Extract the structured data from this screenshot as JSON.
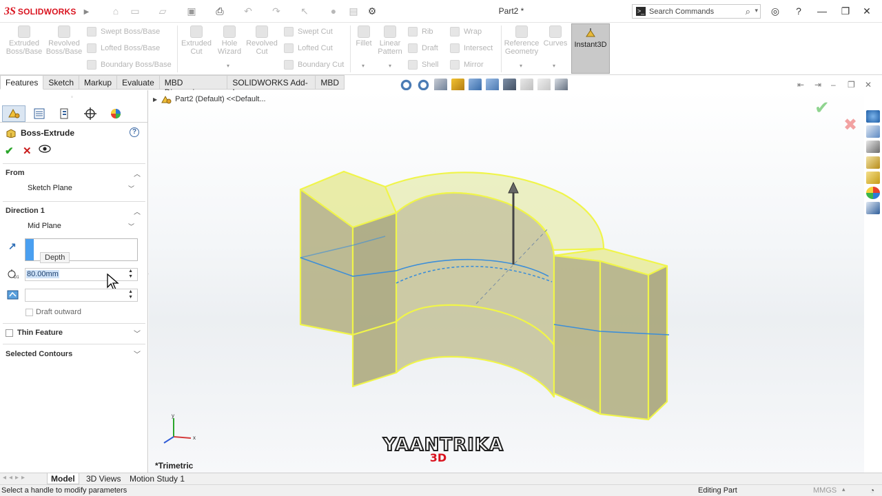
{
  "app": {
    "brand_ds": "3S",
    "brand_name": "SOLIDWORKS",
    "doc_title": "Part2 *"
  },
  "search": {
    "placeholder": "Search Commands",
    "glyph": ">_"
  },
  "commands": {
    "extruded_boss": "Extruded Boss/Base",
    "revolved_boss": "Revolved Boss/Base",
    "swept_boss": "Swept Boss/Base",
    "lofted_boss": "Lofted Boss/Base",
    "boundary_boss": "Boundary Boss/Base",
    "extruded_cut": "Extruded Cut",
    "hole_wizard": "Hole Wizard",
    "revolved_cut": "Revolved Cut",
    "swept_cut": "Swept Cut",
    "lofted_cut": "Lofted Cut",
    "boundary_cut": "Boundary Cut",
    "fillet": "Fillet",
    "linear_pattern": "Linear Pattern",
    "rib": "Rib",
    "draft": "Draft",
    "shell": "Shell",
    "wrap": "Wrap",
    "intersect": "Intersect",
    "mirror": "Mirror",
    "reference_geometry": "Reference Geometry",
    "curves": "Curves",
    "instant3d": "Instant3D"
  },
  "tabs": [
    "Features",
    "Sketch",
    "Markup",
    "Evaluate",
    "MBD Dimensions",
    "SOLIDWORKS Add-Ins",
    "MBD"
  ],
  "property_manager": {
    "title": "Boss-Extrude",
    "help": "?",
    "ok": "✔",
    "cancel": "✕",
    "from_label": "From",
    "from_value": "Sketch Plane",
    "direction_label": "Direction 1",
    "direction_value": "Mid Plane",
    "depth_tooltip": "Depth",
    "depth_value": "80.00mm",
    "draft_outward": "Draft outward",
    "thin_feature": "Thin Feature",
    "selected_contours": "Selected Contours"
  },
  "viewport": {
    "tree_label": "Part2  (Default) <<Default...",
    "view_name": "*Trimetric",
    "watermark": "YAANTRIKA",
    "watermark_sub": "3D",
    "triad_x": "x",
    "triad_y": "y"
  },
  "bottom_tabs": [
    "Model",
    "3D Views",
    "Motion Study 1"
  ],
  "status": {
    "message": "Select a handle to modify parameters",
    "mode": "Editing Part",
    "units": "MMGS"
  },
  "colors": {
    "accent_blue": "#4a9ff0",
    "brand_red": "#d9131f",
    "edge_yellow": "#f0f54a",
    "body_fill": "#b9b68a"
  }
}
